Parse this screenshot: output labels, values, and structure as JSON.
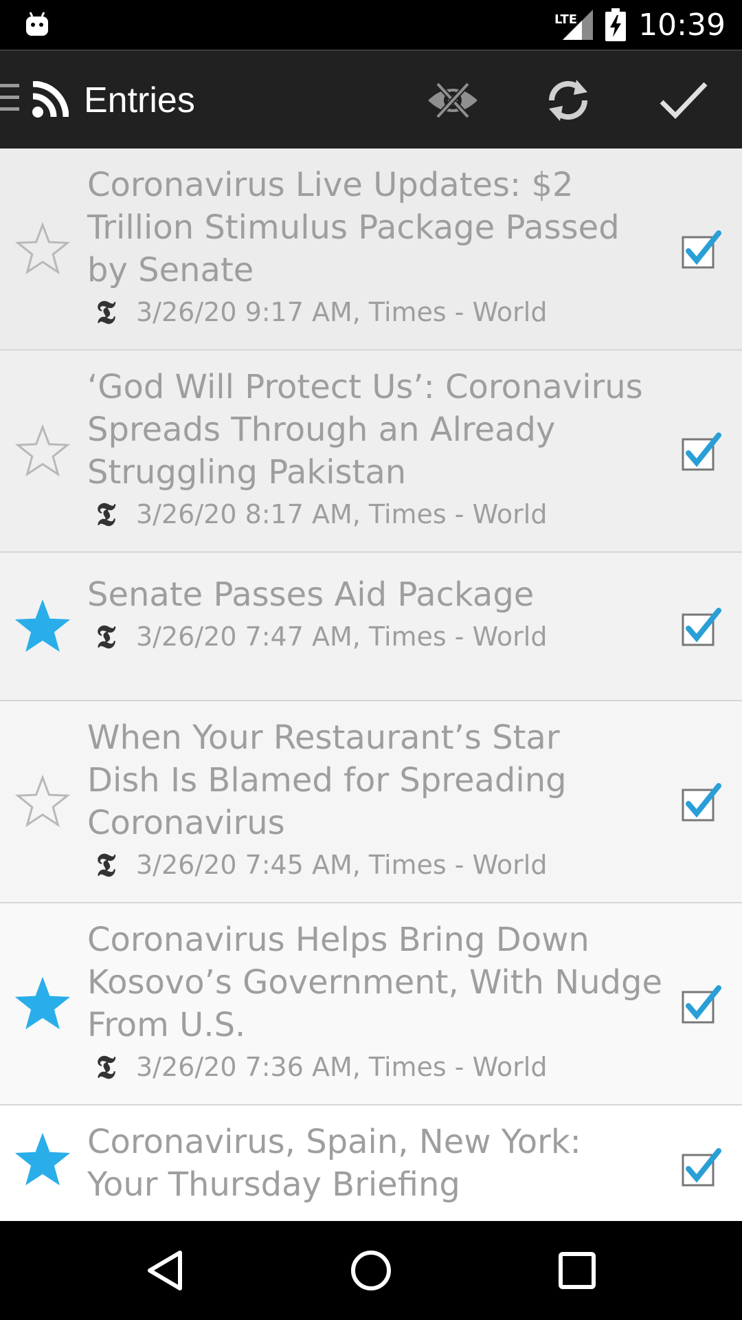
{
  "status_bar": {
    "network_label": "LTE",
    "time": "10:39"
  },
  "app_bar": {
    "title": "Entries",
    "actions": [
      "hide-read-icon",
      "refresh-icon",
      "mark-all-read-icon"
    ]
  },
  "entries": [
    {
      "title_lines": [
        "Coronavirus Live Updates: $2",
        "Trillion Stimulus Package Passed",
        "by Senate"
      ],
      "meta": "3/26/20 9:17 AM, Times - World",
      "starred": false,
      "read": true
    },
    {
      "title_lines": [
        "‘God Will Protect Us’: Coronavirus",
        "Spreads Through an Already",
        "Struggling Pakistan"
      ],
      "meta": "3/26/20 8:17 AM, Times - World",
      "starred": false,
      "read": true
    },
    {
      "title_lines": [
        "Senate Passes Aid Package"
      ],
      "meta": "3/26/20 7:47 AM, Times - World",
      "starred": true,
      "read": true
    },
    {
      "title_lines": [
        "When Your Restaurant’s Star",
        "Dish Is Blamed for Spreading",
        "Coronavirus"
      ],
      "meta": "3/26/20 7:45 AM, Times - World",
      "starred": false,
      "read": true
    },
    {
      "title_lines": [
        "Coronavirus Helps Bring Down",
        "Kosovo’s Government, With Nudge",
        "From U.S."
      ],
      "meta": "3/26/20 7:36 AM, Times - World",
      "starred": true,
      "read": true
    },
    {
      "title_lines": [
        "Coronavirus, Spain, New York:",
        "Your Thursday Briefing"
      ],
      "meta": "",
      "starred": true,
      "read": true
    }
  ],
  "colors": {
    "star_active": "#2aaee9",
    "star_inactive": "#b8b8b8",
    "check_mark": "#2a9fd6",
    "text_read": "#9e9e9e",
    "app_bar": "#212121"
  }
}
